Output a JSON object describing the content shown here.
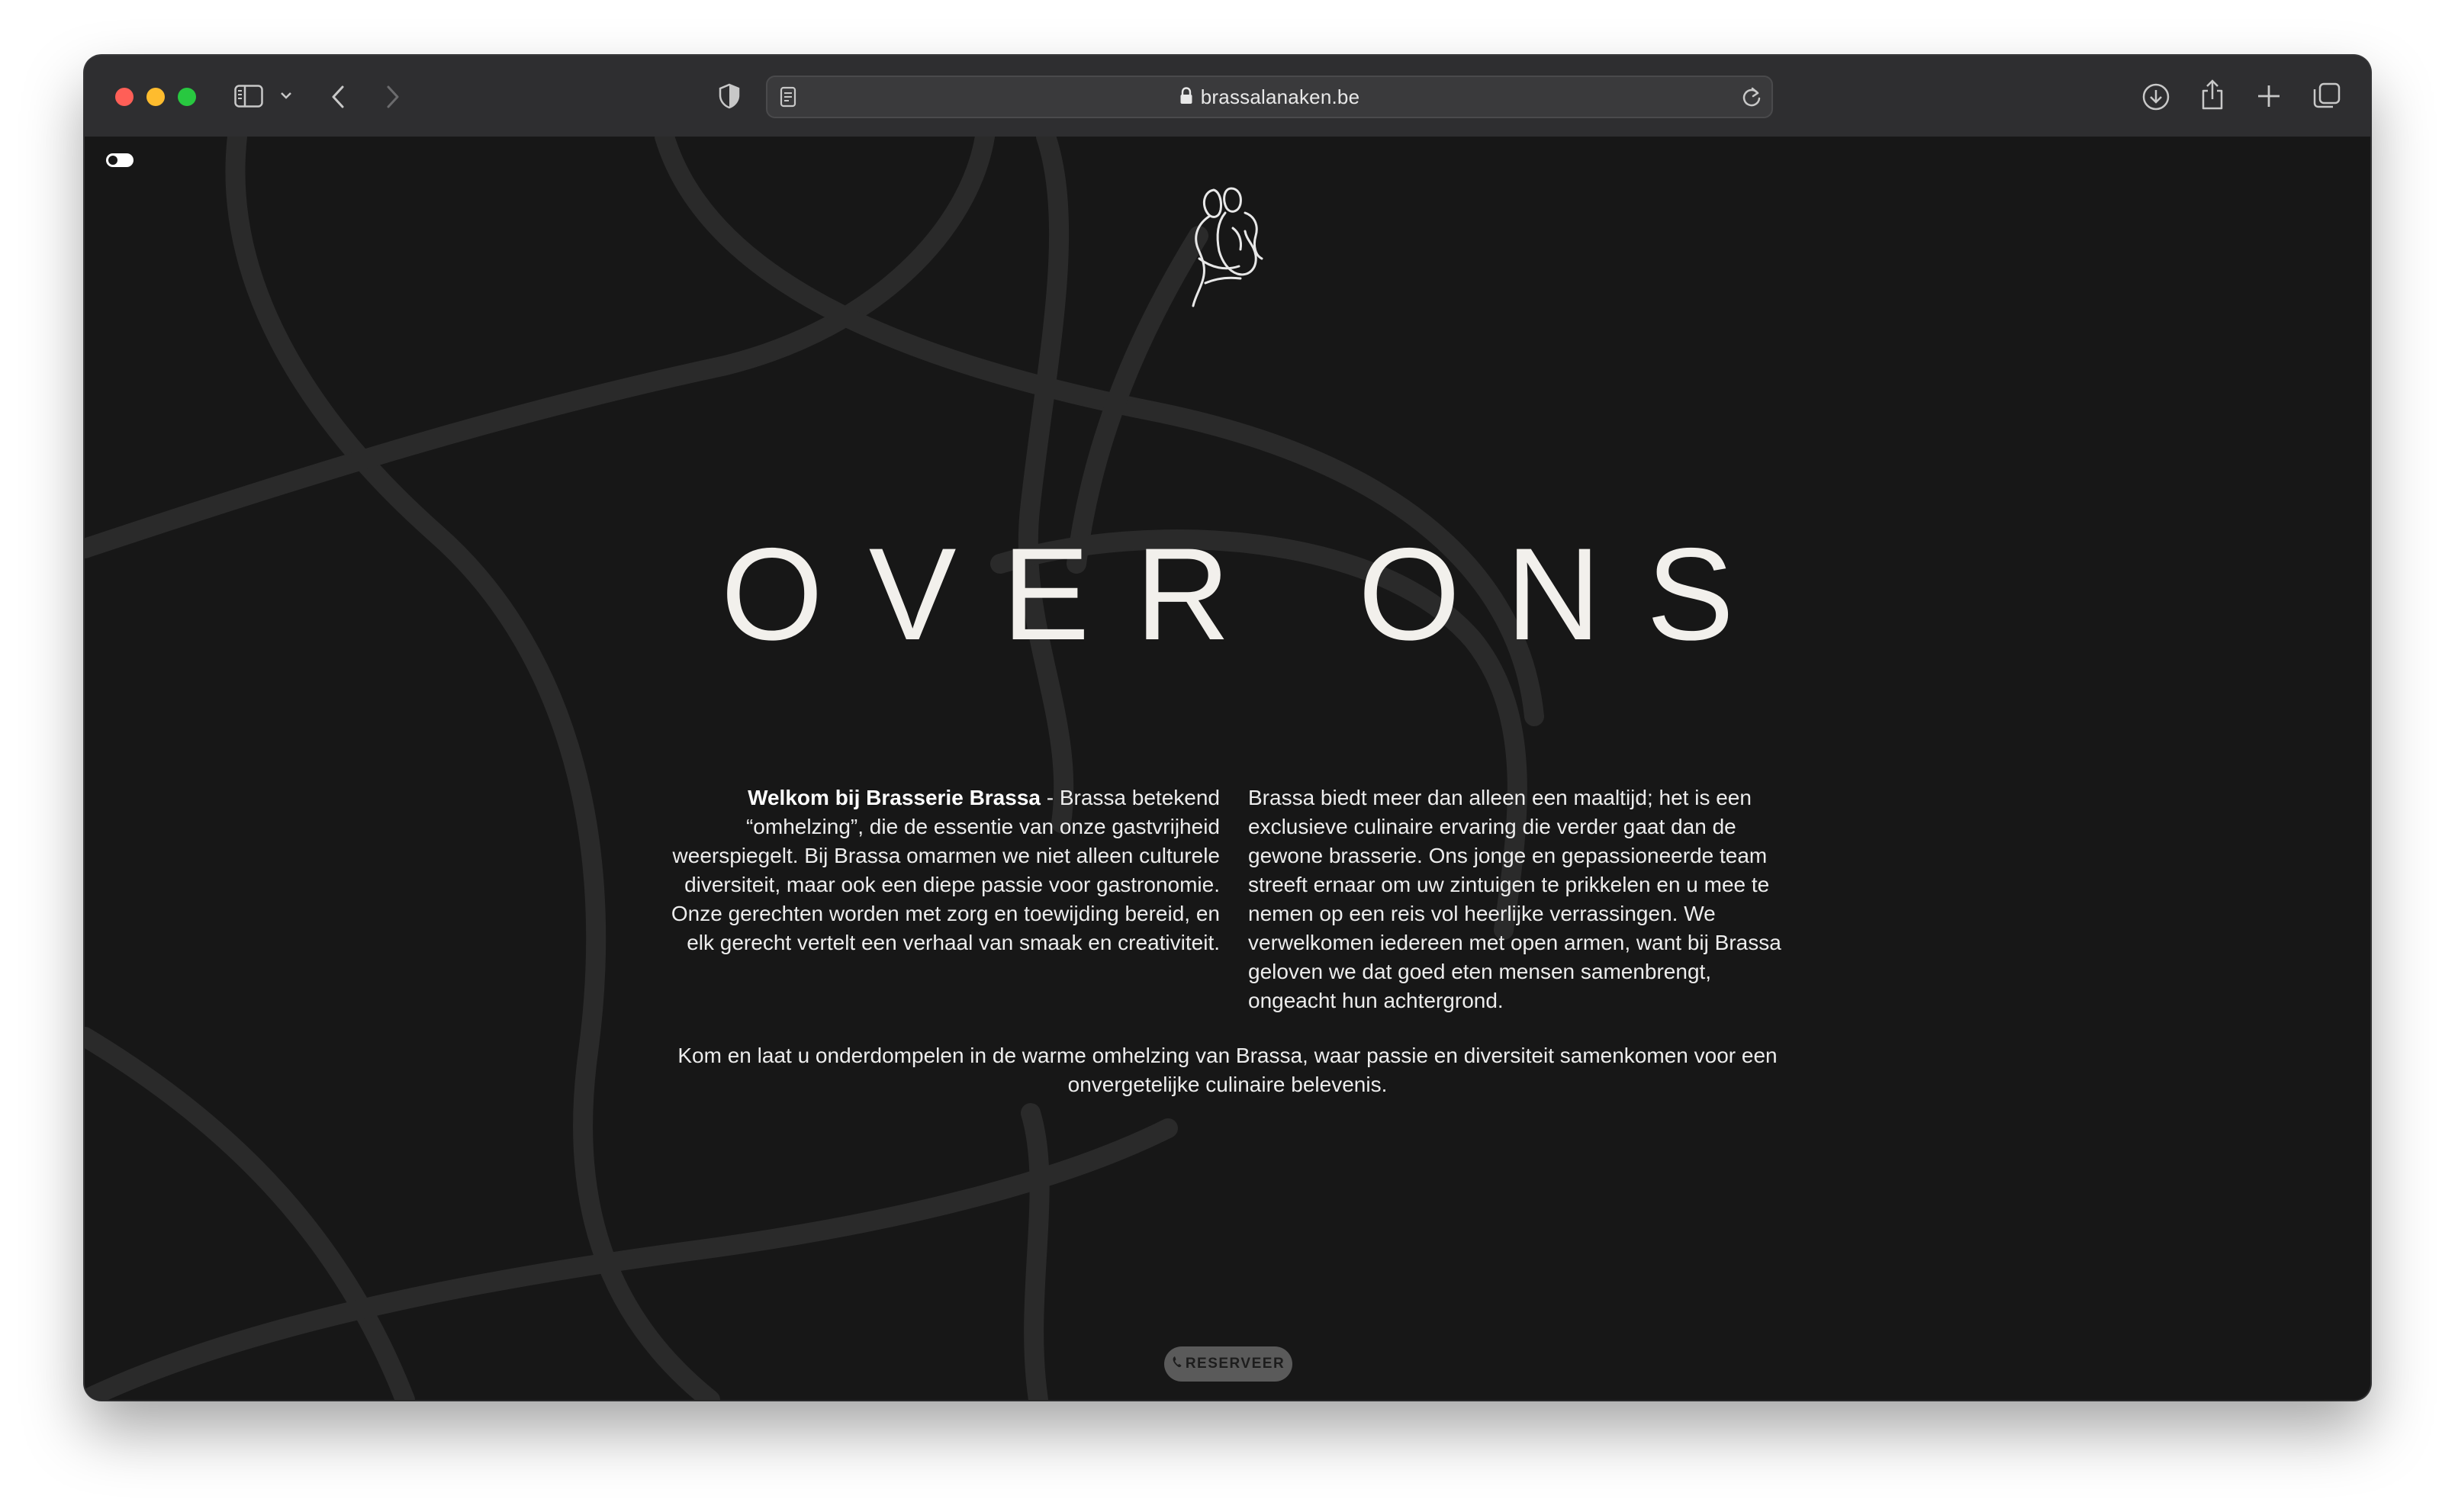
{
  "browser": {
    "url": "brassalanaken.be"
  },
  "page": {
    "title": "OVER ONS",
    "intro_bold": "Welkom bij Brasserie Brassa",
    "intro_rest": " - Brassa betekend “omhelzing”, die de essentie van onze gastvrijheid weerspiegelt. Bij Brassa omarmen we niet alleen culturele diversiteit, maar ook een diepe passie voor gastronomie. Onze gerechten worden met zorg en toewijding bereid, en elk gerecht vertelt een verhaal van smaak en creativiteit.",
    "right_column": "Brassa biedt meer dan alleen een maaltijd; het is een exclusieve culinaire ervaring die verder gaat dan de gewone brasserie. Ons jonge en gepassioneerde team streeft ernaar om uw zintuigen te prikkelen en u mee te nemen op een reis vol heerlijke verrassingen. We verwelkomen iedereen met open armen, want bij Brassa geloven we dat goed eten mensen samenbrengt, ongeacht hun achtergrond.",
    "closing": "Kom en laat u onderdompelen in de warme omhelzing van Brassa, waar passie en diversiteit samenkomen voor een onvergetelijke culinaire belevenis.",
    "reserve_label": "RESERVEER"
  },
  "colors": {
    "background": "#171717",
    "text": "#ededed",
    "button_bg": "#5a5a5a"
  },
  "icons": [
    "sidebar-icon",
    "chevron-down-icon",
    "back-icon",
    "forward-icon",
    "shield-icon",
    "reader-icon",
    "lock-icon",
    "reload-icon",
    "download-icon",
    "share-icon",
    "new-tab-icon",
    "tabs-overview-icon",
    "phone-icon",
    "logo-embrace-icon",
    "theme-toggle"
  ]
}
